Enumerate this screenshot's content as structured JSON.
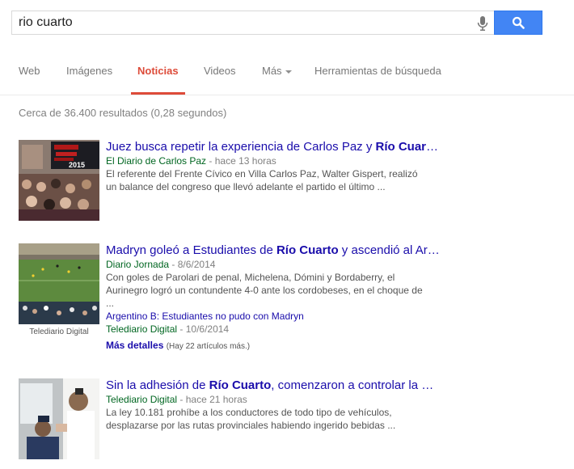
{
  "search": {
    "query": "rio cuarto"
  },
  "tabs": [
    {
      "label": "Web"
    },
    {
      "label": "Imágenes"
    },
    {
      "label": "Noticias"
    },
    {
      "label": "Videos"
    },
    {
      "label": "Más"
    },
    {
      "label": "Herramientas de búsqueda"
    }
  ],
  "stats": "Cerca de 36.400 resultados (0,28 segundos)",
  "results": [
    {
      "title_pre": "Juez busca repetir la experiencia de Carlos Paz y ",
      "title_bold": "Río Cuar",
      "title_post": "…",
      "source": "El Diario de Carlos Paz",
      "time": "hace 13 horas",
      "snippet": "El referente del Frente Cívico en Villa Carlos Paz, Walter Gispert, realizó un balance del congreso que llevó adelante el partido el último ...",
      "banner_text": "2015"
    },
    {
      "title_pre": "Madryn goleó a Estudiantes de ",
      "title_bold": "Río Cuarto",
      "title_post": " y ascendió al Ar…",
      "source": "Diario Jornada",
      "time": "8/6/2014",
      "snippet": "Con goles de Parolari de penal, Michelena, Dómini y Bordaberry, el Aurinegro logró un contundente 4-0 ante los cordobeses, en el choque de ...",
      "thumb_caption": "Telediario Digital",
      "sub_title": "Argentino B: Estudiantes no pudo con Madryn",
      "sub_source": "Telediario Digital",
      "sub_time": "10/6/2014",
      "more_label": "Más detalles",
      "more_count": "(Hay 22 artículos más.)"
    },
    {
      "title_pre": "Sin la adhesión de ",
      "title_bold": "Río Cuarto",
      "title_post": ", comenzaron a controlar la …",
      "source": "Telediario Digital",
      "time": "hace 21 horas",
      "snippet": "La ley 10.181 prohíbe a los conductores de todo tipo de vehículos, desplazarse por las rutas provinciales habiendo ingerido bebidas ..."
    }
  ]
}
